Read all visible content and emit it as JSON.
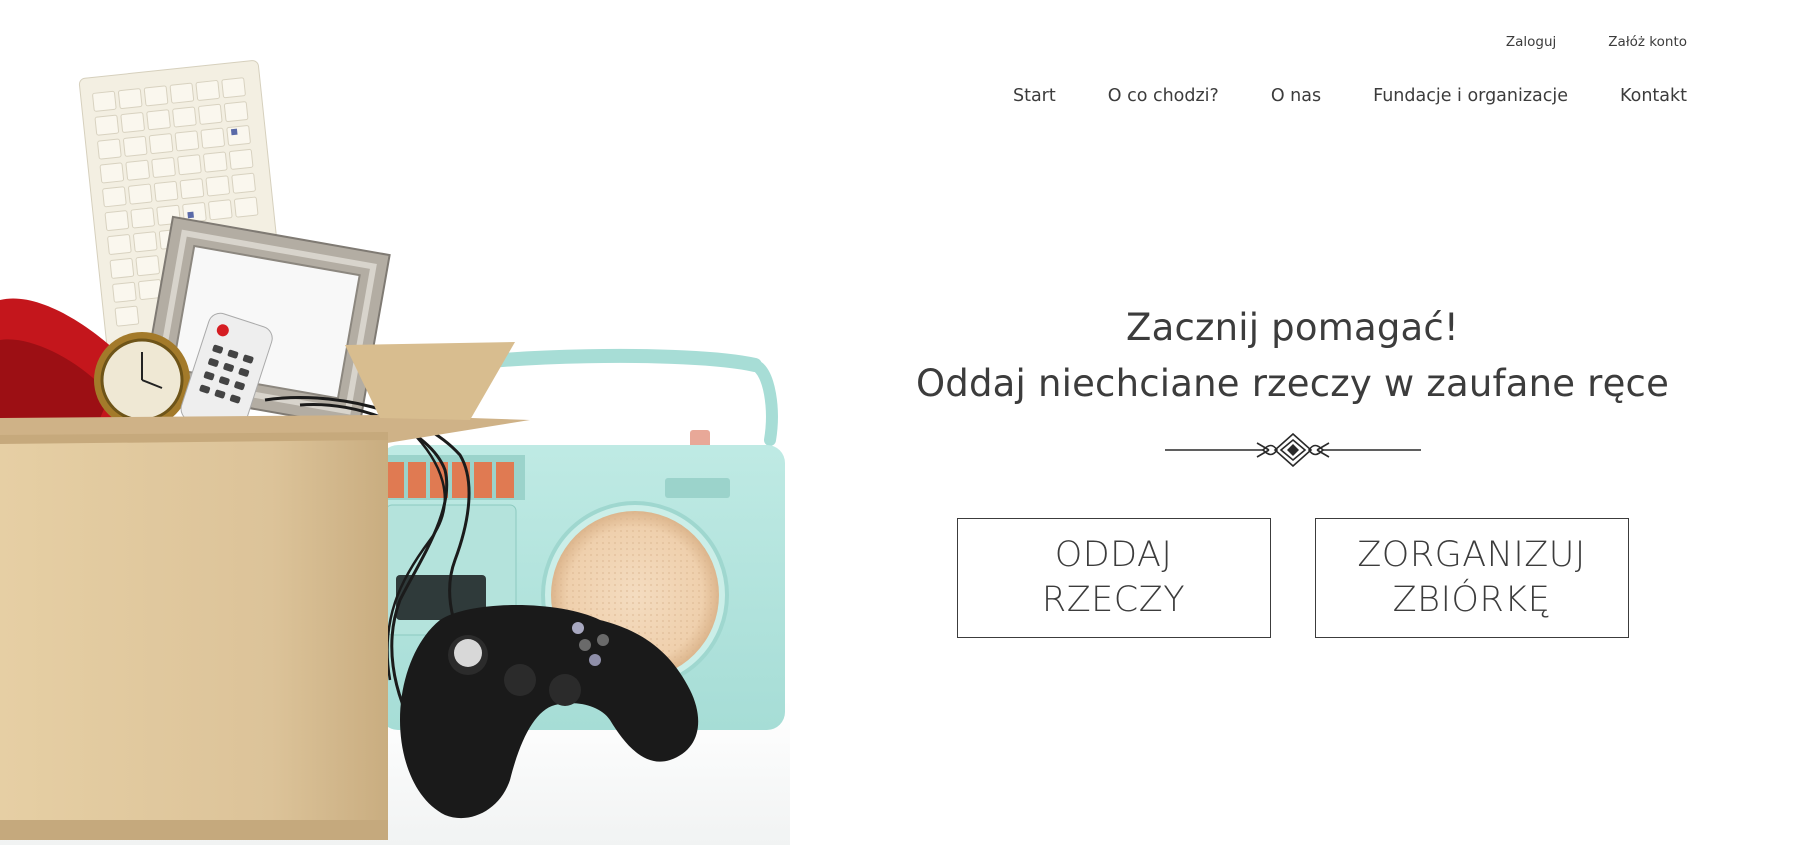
{
  "header": {
    "auth": {
      "login_label": "Zaloguj",
      "register_label": "Załóż konto"
    },
    "nav": {
      "items": [
        {
          "label": "Start"
        },
        {
          "label": "O co chodzi?"
        },
        {
          "label": "O nas"
        },
        {
          "label": "Fundacje i organizacje"
        },
        {
          "label": "Kontakt"
        }
      ]
    }
  },
  "hero": {
    "title_line1": "Zacznij pomagać!",
    "title_line2": "Oddaj niechciane rzeczy w zaufane ręce",
    "buttons": {
      "give_label": "ODDAJ\nRZECZY",
      "organize_label": "ZORGANIZUJ\nZBIÓRKĘ"
    }
  },
  "colors": {
    "text": "#3c3c3c",
    "background": "#ffffff",
    "border": "#3c3c3c"
  },
  "icons": {
    "decoration": "ornament-divider-icon"
  }
}
